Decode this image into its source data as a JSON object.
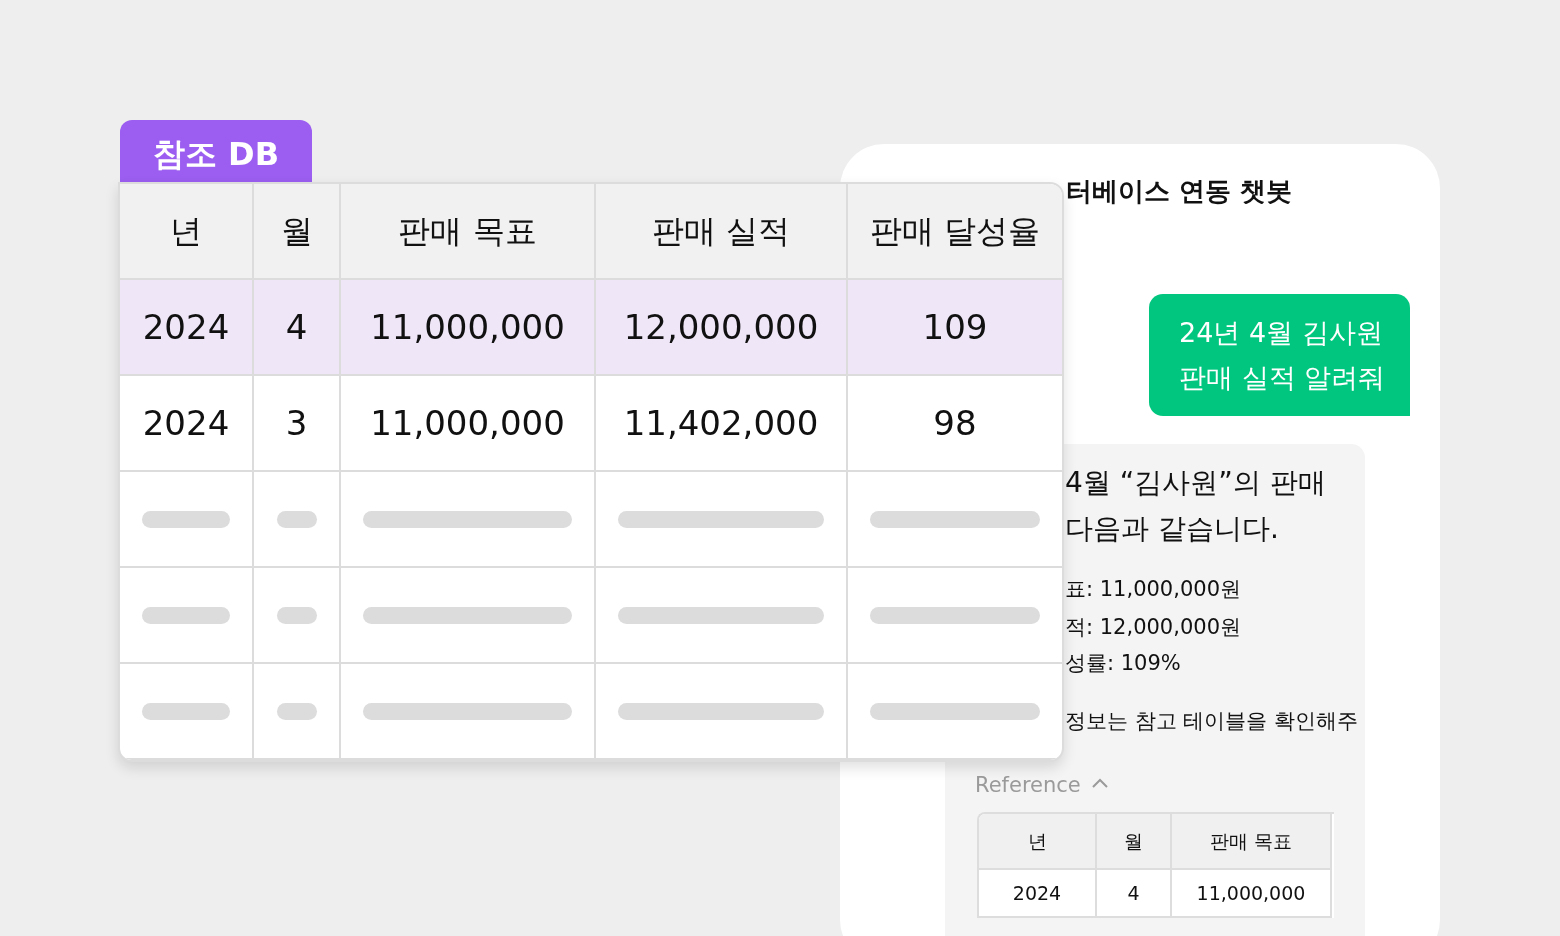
{
  "db_table": {
    "tab": "참조 DB",
    "columns": [
      "년",
      "월",
      "판매 목표",
      "판매 실적",
      "판매 달성율"
    ],
    "rows": [
      {
        "kind": "data",
        "selected": true,
        "cells": [
          "2024",
          "4",
          "11,000,000",
          "12,000,000",
          "109"
        ]
      },
      {
        "kind": "data",
        "selected": false,
        "cells": [
          "2024",
          "3",
          "11,000,000",
          "11,402,000",
          "98"
        ]
      },
      {
        "kind": "skeleton"
      },
      {
        "kind": "skeleton"
      },
      {
        "kind": "skeleton"
      }
    ]
  },
  "chat": {
    "title": "터베이스 연동 챗봇",
    "messages": [
      {
        "kind": "user",
        "lines": [
          "24년 4월 김사원",
          "판매 실적 알려줘"
        ]
      },
      {
        "kind": "bot",
        "lines": [
          {
            "kind": "lead",
            "text": "4월 “김사원”의 판매"
          },
          {
            "kind": "lead",
            "text": "다음과 같습니다."
          },
          {
            "kind": "item",
            "text": "표: 11,000,000원"
          },
          {
            "kind": "item",
            "text": "적: 12,000,000원"
          },
          {
            "kind": "item",
            "text": "성률: 109%"
          },
          {
            "kind": "note",
            "text": "정보는 참고 테이블을 확인해주"
          }
        ],
        "reference": {
          "label": "Reference",
          "expanded": true,
          "columns": [
            "년",
            "월",
            "판매 목표"
          ],
          "rows": [
            [
              "2024",
              "4",
              "11,000,000"
            ]
          ]
        }
      }
    ]
  }
}
